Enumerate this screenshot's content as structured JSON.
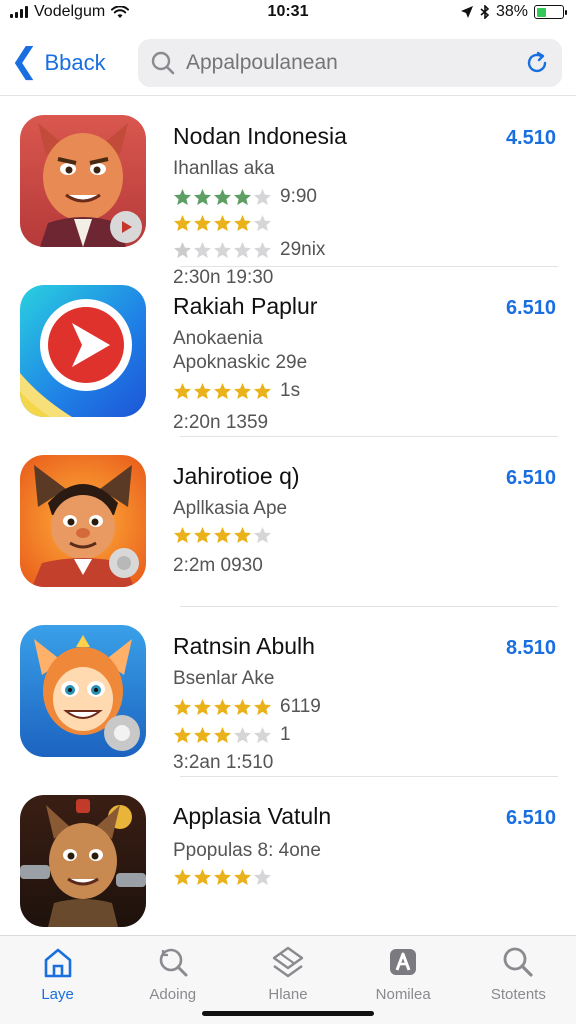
{
  "status": {
    "carrier": "Vodelgum",
    "time": "10:31",
    "battery_text": "38%",
    "battery_level": 0.38
  },
  "nav": {
    "back_label": "Bback",
    "search_placeholder": "Appalpoulanean"
  },
  "apps": [
    {
      "name": "Nodan Indonesia",
      "lines": [
        "Ihanllas aka"
      ],
      "ratings": [
        {
          "stars": 4,
          "color": "#5c9e63",
          "text": "9:90"
        },
        {
          "stars": 4,
          "color": "#e9b11a",
          "text": ""
        },
        {
          "stars": 1,
          "color": "#cccccc",
          "text": "29nix"
        }
      ],
      "meta": "2:30n 19:30",
      "price": "4.510",
      "icon": "character-icon"
    },
    {
      "name": "Rakiah Paplur",
      "lines": [
        "Anokaenia",
        "Apoknaskic 29e"
      ],
      "ratings": [
        {
          "stars": 5,
          "color": "#e9b11a",
          "text": "1s"
        }
      ],
      "meta": "2:20n 1359",
      "price": "6.510",
      "icon": "play-icon"
    },
    {
      "name": "Jahirotioe q)",
      "lines": [
        "Apllkasia Ape"
      ],
      "ratings": [
        {
          "stars": 4,
          "color": "#e9b11a",
          "text": ""
        }
      ],
      "meta": "2:2m 0930",
      "price": "6.510",
      "icon": "character-icon"
    },
    {
      "name": "Ratnsin Abulh",
      "lines": [
        "Bsenlar Ake"
      ],
      "ratings": [
        {
          "stars": 5,
          "color": "#e9b11a",
          "text": "6119"
        },
        {
          "stars": 3,
          "color": "#e9b11a",
          "text": "1"
        }
      ],
      "meta": "3:2an 1:510",
      "price": "8.510",
      "icon": "character-icon"
    },
    {
      "name": "Applasia Vatuln",
      "lines": [
        "Ppopulas 8: 4one"
      ],
      "ratings": [
        {
          "stars": 4,
          "color": "#e9b11a",
          "text": ""
        }
      ],
      "meta": "",
      "price": "6.510",
      "icon": "character-icon"
    }
  ],
  "tabs": [
    {
      "label": "Laye",
      "icon": "home-icon",
      "active": true
    },
    {
      "label": "Adoing",
      "icon": "search-refresh-icon",
      "active": false
    },
    {
      "label": "Hlane",
      "icon": "layers-icon",
      "active": false
    },
    {
      "label": "Nomilea",
      "icon": "app-store-icon",
      "active": false
    },
    {
      "label": "Stotents",
      "icon": "search-icon",
      "active": false
    }
  ]
}
